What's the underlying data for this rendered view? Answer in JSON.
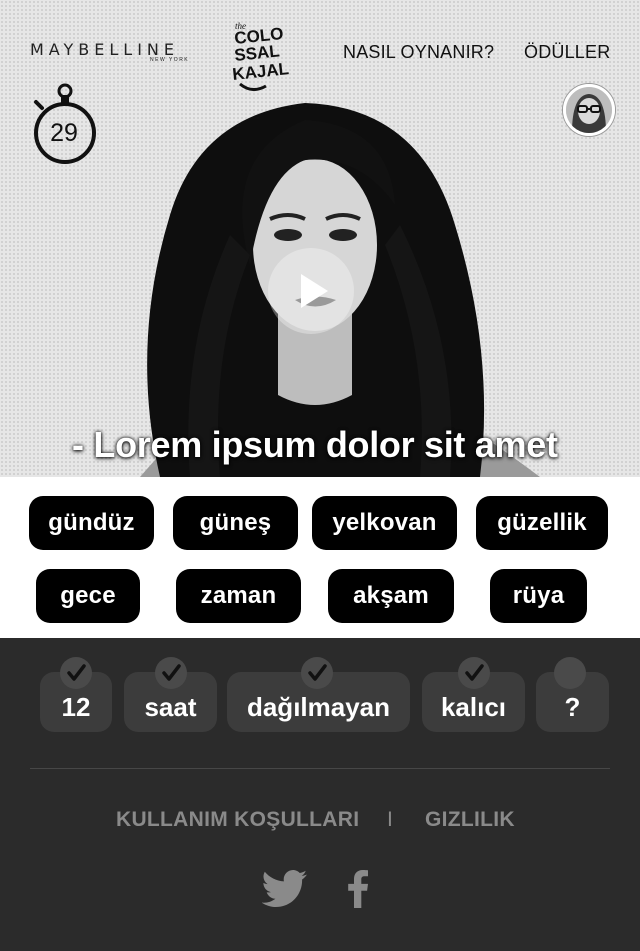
{
  "header": {
    "brand": "MAYBELLINE",
    "brand_sub": "NEW YORK",
    "nav": {
      "how_to_play": "NASIL OYNANIR?",
      "rewards": "ÖDÜLLER"
    }
  },
  "game_logo_text": [
    "the",
    "COLO",
    "SSAL",
    "KAJAL"
  ],
  "timer": {
    "seconds": "29"
  },
  "video": {
    "caption": "- Lorem ipsum dolor sit amet"
  },
  "word_options": {
    "row1": [
      "gündüz",
      "güneş",
      "yelkovan",
      "güzellik"
    ],
    "row2": [
      "gece",
      "zaman",
      "akşam",
      "rüya"
    ]
  },
  "answer_slots": [
    {
      "text": "12",
      "checked": true
    },
    {
      "text": "saat",
      "checked": true
    },
    {
      "text": "dağılmayan",
      "checked": true
    },
    {
      "text": "kalıcı",
      "checked": true
    },
    {
      "text": "?",
      "checked": false
    }
  ],
  "footer": {
    "terms": "KULLANIM KOŞULLARI",
    "separator": "I",
    "privacy": "GIZLILIK"
  },
  "icons": [
    "stopwatch-icon",
    "play-icon",
    "check-icon",
    "twitter-icon",
    "facebook-icon"
  ],
  "colors": {
    "button": "#000000",
    "answer_bg": "#2b2b2b",
    "slot": "#3c3c3c",
    "footer_text": "#8a8a8a"
  }
}
